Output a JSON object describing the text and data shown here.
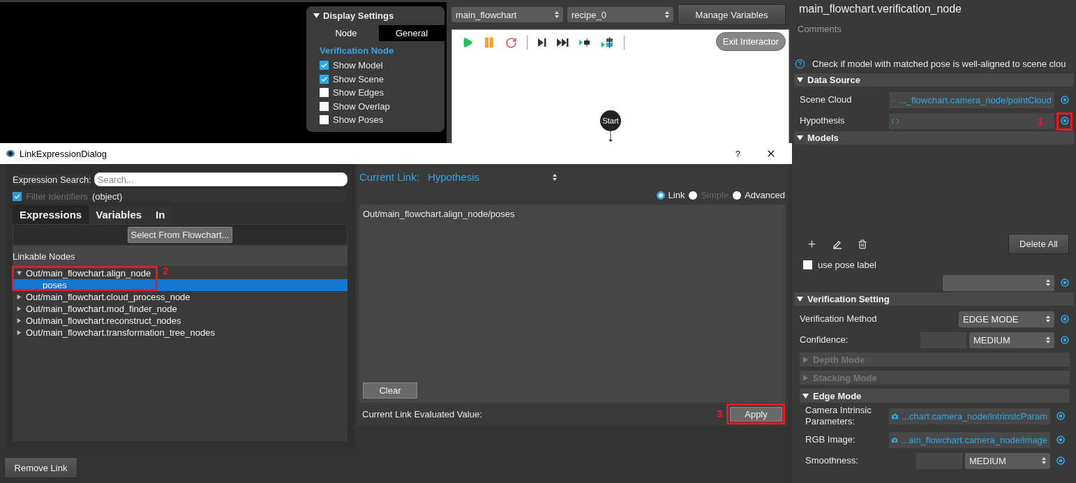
{
  "viewport": {
    "display_settings": {
      "title": "Display Settings",
      "expanded": true,
      "tabs": [
        {
          "label": "Node",
          "selected": false
        },
        {
          "label": "General",
          "selected": true
        }
      ],
      "section": "Verification Node",
      "options": [
        {
          "label": "Show Model",
          "checked": true
        },
        {
          "label": "Show Scene",
          "checked": true
        },
        {
          "label": "Show Edges",
          "checked": false
        },
        {
          "label": "Show Overlap",
          "checked": false
        },
        {
          "label": "Show Poses",
          "checked": false
        }
      ]
    }
  },
  "flowchart": {
    "flowchart_select": "main_flowchart",
    "recipe_select": "recipe_0",
    "manage_button": "Manage Variables",
    "exit_button": "Exit Interactor",
    "start_node": "Start"
  },
  "dialog": {
    "title": "LinkExpressionDialog",
    "help": "?",
    "search_label": "Expression Search:",
    "search_placeholder": "Search...",
    "filter": {
      "label": "Filter Identifiers",
      "checked": true,
      "disabled": true
    },
    "filter_type": "(object)",
    "tabs": [
      {
        "label": "Expressions",
        "selected": true
      },
      {
        "label": "Variables",
        "selected": false
      },
      {
        "label": "In",
        "selected": false
      }
    ],
    "select_button": "Select From Flowchart...",
    "tree_header": "Linkable Nodes",
    "tree": [
      {
        "label": "Out/main_flowchart.align_node",
        "expanded": true,
        "selected": false,
        "annotation": "2",
        "children": [
          {
            "label": "poses",
            "selected": true
          }
        ]
      },
      {
        "label": "Out/main_flowchart.cloud_process_node",
        "expanded": false,
        "selected": false
      },
      {
        "label": "Out/main_flowchart.mod_finder_node",
        "expanded": false,
        "selected": false
      },
      {
        "label": "Out/main_flowchart.reconstruct_nodes",
        "expanded": false,
        "selected": false
      },
      {
        "label": "Out/main_flowchart.transformation_tree_nodes",
        "expanded": false,
        "selected": false
      }
    ],
    "current_link_label": "Current Link:",
    "current_link_value": "Hypothesis",
    "modes": [
      {
        "label": "Link",
        "selected": true,
        "disabled": false
      },
      {
        "label": "Simple",
        "selected": false,
        "disabled": true
      },
      {
        "label": "Advanced",
        "selected": false,
        "disabled": false
      }
    ],
    "expression": "Out/main_flowchart.align_node/poses",
    "clear_button": "Clear",
    "evaluated_label": "Current Link Evaluated Value:",
    "apply_button": {
      "label": "Apply",
      "annotation": "3"
    },
    "remove_button": "Remove Link"
  },
  "properties": {
    "title": "main_flowchart.verification_node",
    "comments_placeholder": "Comments",
    "description": "Check if model with matched pose is well-aligned to scene clou",
    "sections": [
      {
        "kind": "rows",
        "title": "Data Source",
        "expanded": true,
        "disabled": false,
        "rows": [
          {
            "kind": "code_link",
            "label": "Scene Cloud",
            "value": "..._flowchart.camera_node/pointCloud"
          },
          {
            "kind": "code_link",
            "label": "Hypothesis",
            "annotation": "1"
          }
        ]
      },
      {
        "kind": "models",
        "title": "Models",
        "expanded": true,
        "disabled": false,
        "delete_button": "Delete All",
        "use_pose_label": {
          "label": "use pose label",
          "checked": false
        }
      },
      {
        "kind": "rows",
        "title": "Verification Setting",
        "expanded": true,
        "disabled": false,
        "rows": [
          {
            "kind": "select",
            "label": "Verification Method",
            "value": "EDGE MODE"
          },
          {
            "kind": "level_select",
            "label": "Confidence:",
            "value": "MEDIUM"
          },
          {
            "kind": "subsection",
            "title": "Depth Mode",
            "expanded": false,
            "disabled": true
          },
          {
            "kind": "subsection",
            "title": "Stacking Mode",
            "expanded": false,
            "disabled": true
          },
          {
            "kind": "subsection",
            "title": "Edge Mode",
            "expanded": true,
            "disabled": false,
            "rows": [
              {
                "kind": "camera_link",
                "label": "Camera Intrinsic Parameters:",
                "value": "...chart.camera_node/intrinsicParam"
              },
              {
                "kind": "camera_link",
                "label": "RGB Image:",
                "value": "...ain_flowchart.camera_node/image"
              },
              {
                "kind": "level_select",
                "label": "Smoothness:",
                "value": "MEDIUM"
              }
            ]
          }
        ]
      }
    ]
  }
}
